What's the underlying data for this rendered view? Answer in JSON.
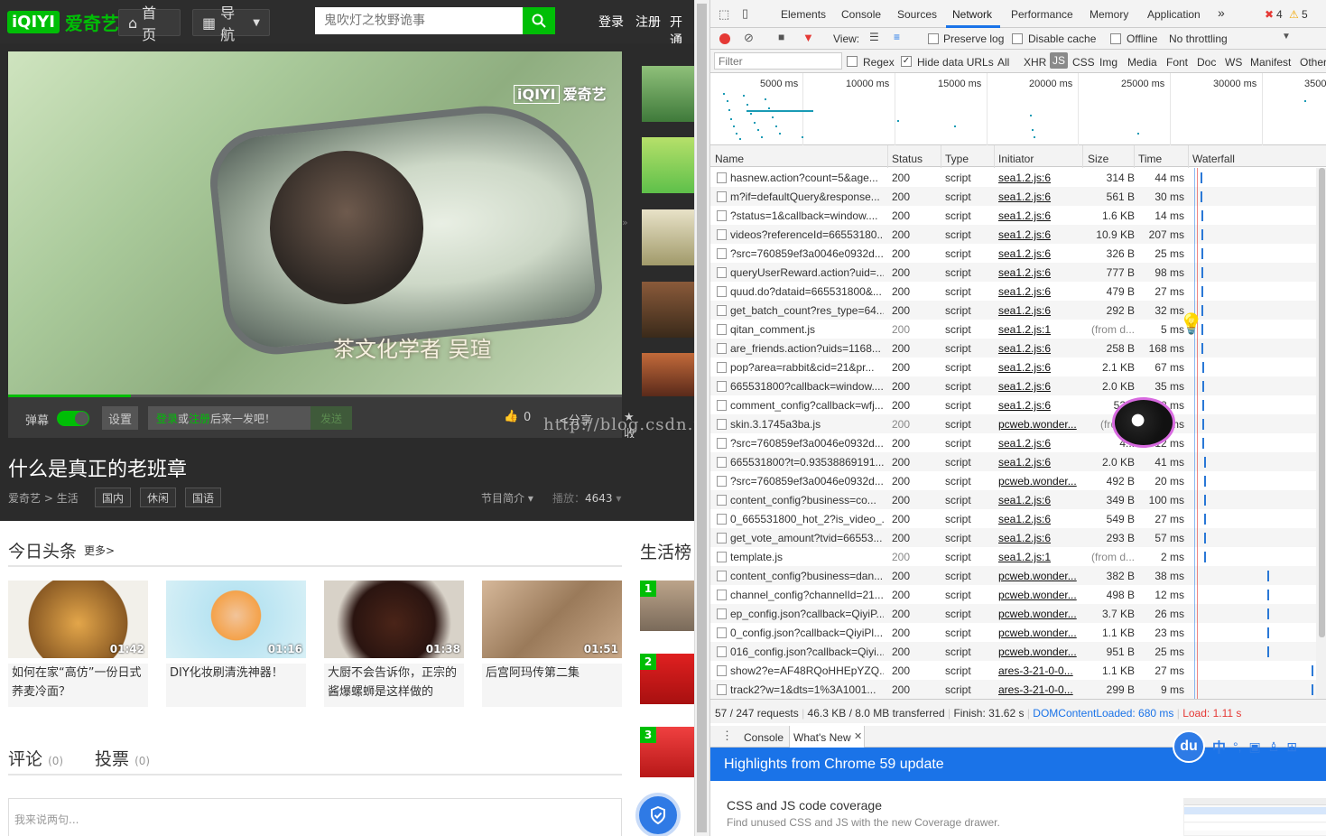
{
  "site": {
    "logo_mark": "iQIYI",
    "logo_text": "爱奇艺",
    "nav_home": "首页",
    "nav_guide": "导航",
    "search_placeholder": "鬼吹灯之牧野诡事",
    "login": "登录",
    "register": "注册",
    "open": "开通",
    "video_watermark": "爱奇艺",
    "video_watermark_mark": "iQIYI",
    "subtitle": "茶文化学者  吴瑄",
    "danmu_label": "弹幕",
    "settings_label": "设置",
    "comment_prompt_login": "登录",
    "comment_prompt_or": "或",
    "comment_prompt_register": "注册",
    "comment_prompt_rest": "后来一发吧！",
    "send_label": "发送",
    "like_count": "0",
    "share_label": "分享",
    "fav_label": "收藏",
    "video_title": "什么是真正的老班章",
    "breadcrumb_1": "爱奇艺",
    "breadcrumb_sep": ">",
    "breadcrumb_2": "生活",
    "tags": [
      "国内",
      "休闲",
      "国语"
    ],
    "intro_label": "节目简介",
    "play_label": "播放：",
    "play_count": "4643",
    "headline_title": "今日头条",
    "more_label": "更多>",
    "life_rank_title": "生活榜",
    "cards": [
      {
        "duration": "01:42",
        "title": "如何在家“高仿”一份日式荞麦冷面？"
      },
      {
        "duration": "01:16",
        "title": "DIY化妆刷清洗神器！"
      },
      {
        "duration": "01:38",
        "title": "大厨不会告诉你，正宗的酱爆螺蛳是这样做的"
      },
      {
        "duration": "01:51",
        "title": "后宫阿玛传第二集"
      }
    ],
    "ranks": [
      "1",
      "2",
      "3"
    ],
    "comment_tab": "评论",
    "comment_count": "(0)",
    "vote_tab": "投票",
    "vote_count": "(0)",
    "comment_placeholder": "我来说两句...",
    "blog_watermark": "http://blog.csdn.net/..."
  },
  "devtools": {
    "tabs": [
      "Elements",
      "Console",
      "Sources",
      "Network",
      "Performance",
      "Memory",
      "Application"
    ],
    "more_tabs": "»",
    "errors": "4",
    "warnings": "5",
    "view_label": "View:",
    "preserve_log": "Preserve log",
    "disable_cache": "Disable cache",
    "offline": "Offline",
    "throttling": "No throttling",
    "filter_placeholder": "Filter",
    "regex": "Regex",
    "hide_data_urls": "Hide data URLs",
    "types": [
      "All",
      "XHR",
      "JS",
      "CSS",
      "Img",
      "Media",
      "Font",
      "Doc",
      "WS",
      "Manifest",
      "Other"
    ],
    "overview_ticks": [
      "5000 ms",
      "10000 ms",
      "15000 ms",
      "20000 ms",
      "25000 ms",
      "30000 ms",
      "3500"
    ],
    "columns": [
      "Name",
      "Status",
      "Type",
      "Initiator",
      "Size",
      "Time",
      "Waterfall"
    ],
    "rows": [
      {
        "name": "hasnew.action?count=5&age...",
        "status": "200",
        "type": "script",
        "initiator": "sea1.2.js:6",
        "size": "314 B",
        "time": "44 ms",
        "wf": 0.02
      },
      {
        "name": "m?if=defaultQuery&response...",
        "status": "200",
        "type": "script",
        "initiator": "sea1.2.js:6",
        "size": "561 B",
        "time": "30 ms",
        "wf": 0.02
      },
      {
        "name": "?status=1&callback=window....",
        "status": "200",
        "type": "script",
        "initiator": "sea1.2.js:6",
        "size": "1.6 KB",
        "time": "14 ms",
        "wf": 0.03
      },
      {
        "name": "videos?referenceId=66553180...",
        "status": "200",
        "type": "script",
        "initiator": "sea1.2.js:6",
        "size": "10.9 KB",
        "time": "207 ms",
        "wf": 0.03
      },
      {
        "name": "?src=760859ef3a0046e0932d...",
        "status": "200",
        "type": "script",
        "initiator": "sea1.2.js:6",
        "size": "326 B",
        "time": "25 ms",
        "wf": 0.03
      },
      {
        "name": "queryUserReward.action?uid=...",
        "status": "200",
        "type": "script",
        "initiator": "sea1.2.js:6",
        "size": "777 B",
        "time": "98 ms",
        "wf": 0.03
      },
      {
        "name": "quud.do?dataid=665531800&...",
        "status": "200",
        "type": "script",
        "initiator": "sea1.2.js:6",
        "size": "479 B",
        "time": "27 ms",
        "wf": 0.03
      },
      {
        "name": "get_batch_count?res_type=64...",
        "status": "200",
        "type": "script",
        "initiator": "sea1.2.js:6",
        "size": "292 B",
        "time": "32 ms",
        "wf": 0.03
      },
      {
        "name": "qitan_comment.js",
        "status": "200",
        "type": "script",
        "initiator": "sea1.2.js:1",
        "size": "(from d...",
        "time": "5 ms",
        "wf": 0.03
      },
      {
        "name": "are_friends.action?uids=1168...",
        "status": "200",
        "type": "script",
        "initiator": "sea1.2.js:6",
        "size": "258 B",
        "time": "168 ms",
        "wf": 0.03
      },
      {
        "name": "pop?area=rabbit&cid=21&pr...",
        "status": "200",
        "type": "script",
        "initiator": "sea1.2.js:6",
        "size": "2.1 KB",
        "time": "67 ms",
        "wf": 0.04
      },
      {
        "name": "665531800?callback=window....",
        "status": "200",
        "type": "script",
        "initiator": "sea1.2.js:6",
        "size": "2.0 KB",
        "time": "35 ms",
        "wf": 0.04
      },
      {
        "name": "comment_config?callback=wfj...",
        "status": "200",
        "type": "script",
        "initiator": "sea1.2.js:6",
        "size": "52...",
        "time": "8 ms",
        "wf": 0.04
      },
      {
        "name": "skin.3.1745a3ba.js",
        "status": "200",
        "type": "script",
        "initiator": "pcweb.wonder...",
        "size": "(from...",
        "time": "ms",
        "wf": 0.04
      },
      {
        "name": "?src=760859ef3a0046e0932d...",
        "status": "200",
        "type": "script",
        "initiator": "sea1.2.js:6",
        "size": "4...",
        "time": "12 ms",
        "wf": 0.04
      },
      {
        "name": "665531800?t=0.93538869191...",
        "status": "200",
        "type": "script",
        "initiator": "sea1.2.js:6",
        "size": "2.0 KB",
        "time": "41 ms",
        "wf": 0.05
      },
      {
        "name": "?src=760859ef3a0046e0932d...",
        "status": "200",
        "type": "script",
        "initiator": "pcweb.wonder...",
        "size": "492 B",
        "time": "20 ms",
        "wf": 0.05
      },
      {
        "name": "content_config?business=co...",
        "status": "200",
        "type": "script",
        "initiator": "sea1.2.js:6",
        "size": "349 B",
        "time": "100 ms",
        "wf": 0.05
      },
      {
        "name": "0_665531800_hot_2?is_video_...",
        "status": "200",
        "type": "script",
        "initiator": "sea1.2.js:6",
        "size": "549 B",
        "time": "27 ms",
        "wf": 0.05
      },
      {
        "name": "get_vote_amount?tvid=66553...",
        "status": "200",
        "type": "script",
        "initiator": "sea1.2.js:6",
        "size": "293 B",
        "time": "57 ms",
        "wf": 0.05
      },
      {
        "name": "template.js",
        "status": "200",
        "type": "script",
        "initiator": "sea1.2.js:1",
        "size": "(from d...",
        "time": "2 ms",
        "wf": 0.05
      },
      {
        "name": "content_config?business=dan...",
        "status": "200",
        "type": "script",
        "initiator": "pcweb.wonder...",
        "size": "382 B",
        "time": "38 ms",
        "wf": 0.59
      },
      {
        "name": "channel_config?channelId=21...",
        "status": "200",
        "type": "script",
        "initiator": "pcweb.wonder...",
        "size": "498 B",
        "time": "12 ms",
        "wf": 0.59
      },
      {
        "name": "ep_config.json?callback=QiyiP...",
        "status": "200",
        "type": "script",
        "initiator": "pcweb.wonder...",
        "size": "3.7 KB",
        "time": "26 ms",
        "wf": 0.59
      },
      {
        "name": "0_config.json?callback=QiyiPl...",
        "status": "200",
        "type": "script",
        "initiator": "pcweb.wonder...",
        "size": "1.1 KB",
        "time": "23 ms",
        "wf": 0.59
      },
      {
        "name": "016_config.json?callback=Qiyi...",
        "status": "200",
        "type": "script",
        "initiator": "pcweb.wonder...",
        "size": "951 B",
        "time": "25 ms",
        "wf": 0.59
      },
      {
        "name": "show2?e=AF48RQoHHEpYZQ...",
        "status": "200",
        "type": "script",
        "initiator": "ares-3-21-0-0...",
        "size": "1.1 KB",
        "time": "27 ms",
        "wf": 0.97
      },
      {
        "name": "track2?w=1&dts=1%3A1001...",
        "status": "200",
        "type": "script",
        "initiator": "ares-3-21-0-0...",
        "size": "299 B",
        "time": "9 ms",
        "wf": 0.97
      }
    ],
    "summary_requests": "57 / 247 requests",
    "summary_transferred": "46.3 KB / 8.0 MB transferred",
    "summary_finish": "Finish: 31.62 s",
    "summary_dcl": "DOMContentLoaded: 680 ms",
    "summary_load": "Load: 1.11 s",
    "drawer_console": "Console",
    "drawer_whatsnew": "What's New",
    "whatsnew_title": "Highlights from Chrome 59 update",
    "coverage_title": "CSS and JS code coverage",
    "coverage_desc": "Find unused CSS and JS with the new Coverage drawer.",
    "ime_chars": [
      "中",
      "°,",
      "▣",
      "♙",
      "⊞"
    ],
    "ime_logo": "du",
    "colors": {
      "accent_green": "#00be06",
      "devtools_blue": "#1a73e8",
      "link_blue": "#1a73e8",
      "error_red": "#e53935"
    }
  }
}
